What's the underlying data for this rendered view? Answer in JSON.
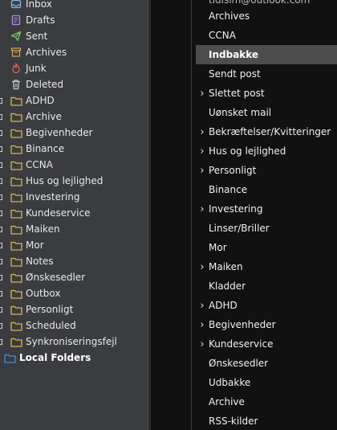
{
  "left_pane": {
    "top_items": [
      {
        "label": "Inbox",
        "icon": "inbox-icon"
      },
      {
        "label": "Drafts",
        "icon": "drafts-icon"
      },
      {
        "label": "Sent",
        "icon": "sent-icon"
      },
      {
        "label": "Archives",
        "icon": "archives-icon"
      },
      {
        "label": "Junk",
        "icon": "junk-icon"
      },
      {
        "label": "Deleted",
        "icon": "deleted-icon"
      }
    ],
    "folders": [
      "ADHD",
      "Archive",
      "Begivenheder",
      "Binance",
      "CCNA",
      "Hus og lejlighed",
      "Investering",
      "Kundeservice",
      "Maiken",
      "Mor",
      "Notes",
      "Ønskesedler",
      "Outbox",
      "Personligt",
      "Scheduled",
      "Synkroniseringsfejl"
    ],
    "local_folders": "Local Folders"
  },
  "right_pane": {
    "cut_header": "tidlsim@outlook.com",
    "items": [
      {
        "label": "Archives",
        "chevron": false
      },
      {
        "label": "CCNA",
        "chevron": false
      },
      {
        "label": "Indbakke",
        "chevron": false,
        "selected": true
      },
      {
        "label": "Sendt post",
        "chevron": false
      },
      {
        "label": "Slettet post",
        "chevron": true
      },
      {
        "label": "Uønsket mail",
        "chevron": false
      },
      {
        "label": "Bekræftelser/Kvitteringer",
        "chevron": true
      },
      {
        "label": "Hus og lejlighed",
        "chevron": true
      },
      {
        "label": "Personligt",
        "chevron": true
      },
      {
        "label": "Binance",
        "chevron": false
      },
      {
        "label": "Investering",
        "chevron": true
      },
      {
        "label": "Linser/Briller",
        "chevron": false
      },
      {
        "label": "Mor",
        "chevron": false
      },
      {
        "label": "Maiken",
        "chevron": true
      },
      {
        "label": "Kladder",
        "chevron": false
      },
      {
        "label": "ADHD",
        "chevron": true
      },
      {
        "label": "Begivenheder",
        "chevron": true
      },
      {
        "label": "Kundeservice",
        "chevron": true
      },
      {
        "label": "Ønskesedler",
        "chevron": false
      },
      {
        "label": "Udbakke",
        "chevron": false
      },
      {
        "label": "Archive",
        "chevron": false
      },
      {
        "label": "RSS-kilder",
        "chevron": false
      }
    ]
  },
  "colors": {
    "folder": "#e3b341",
    "local_folder": "#3d8fd6",
    "inbox": "#7fb6e8",
    "drafts": "#b18be0",
    "sent": "#7cc46a",
    "archives": "#d9a55a",
    "junk": "#e26a5a",
    "deleted": "#c9c9c9"
  }
}
